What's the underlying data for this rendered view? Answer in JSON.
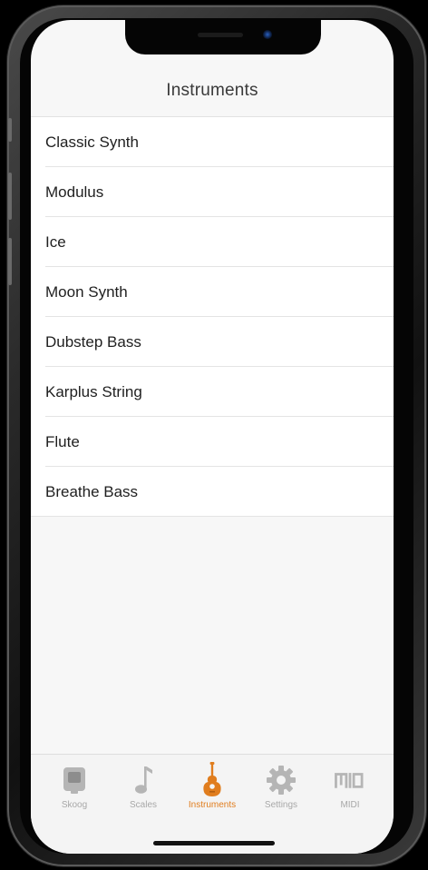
{
  "nav": {
    "title": "Instruments"
  },
  "instruments": [
    {
      "label": "Classic Synth"
    },
    {
      "label": "Modulus"
    },
    {
      "label": "Ice"
    },
    {
      "label": "Moon Synth"
    },
    {
      "label": "Dubstep Bass"
    },
    {
      "label": "Karplus String"
    },
    {
      "label": "Flute"
    },
    {
      "label": "Breathe Bass"
    }
  ],
  "tabs": [
    {
      "label": "Skoog",
      "icon": "skoog-icon",
      "active": false
    },
    {
      "label": "Scales",
      "icon": "music-note-icon",
      "active": false
    },
    {
      "label": "Instruments",
      "icon": "guitar-icon",
      "active": true
    },
    {
      "label": "Settings",
      "icon": "gear-icon",
      "active": false
    },
    {
      "label": "MIDI",
      "icon": "midi-icon",
      "active": false
    }
  ],
  "colors": {
    "accent": "#e07d1e",
    "inactive": "#a8a8a8",
    "background": "#f7f7f7"
  }
}
